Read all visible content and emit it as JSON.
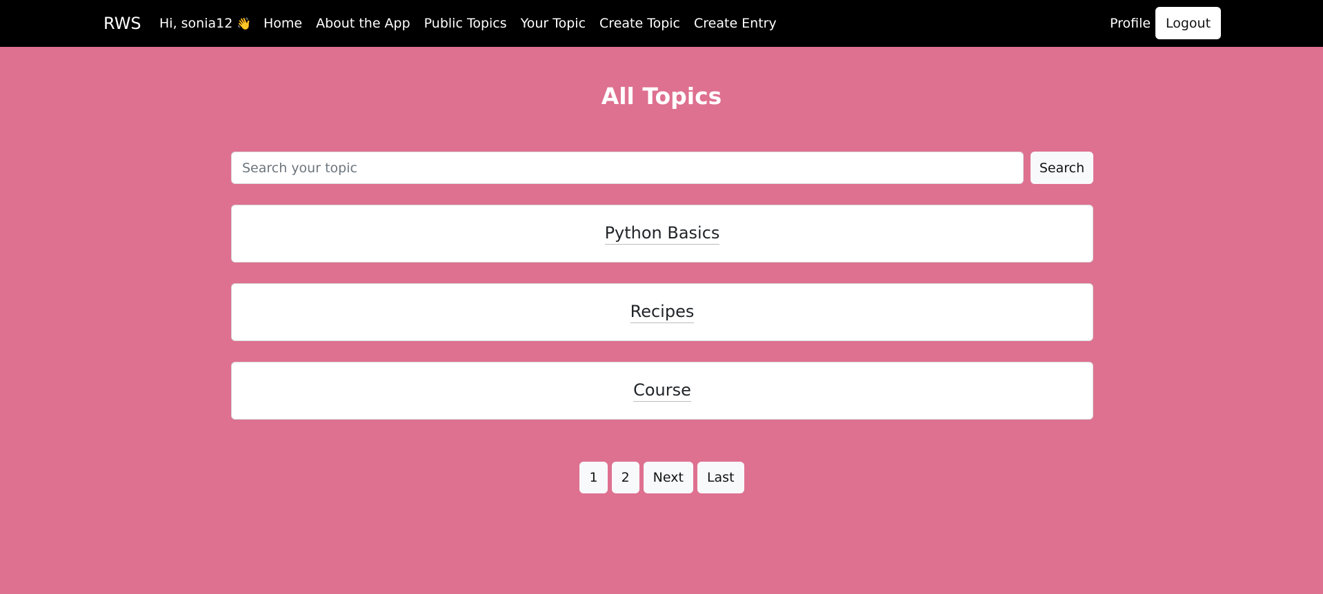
{
  "navbar": {
    "brand": "RWS",
    "greeting": "Hi, sonia12",
    "greeting_emoji": "👋",
    "links": [
      "Home",
      "About the App",
      "Public Topics",
      "Your Topic",
      "Create Topic",
      "Create Entry"
    ],
    "profile": "Profile",
    "logout": "Logout"
  },
  "main": {
    "title": "All Topics",
    "search": {
      "placeholder": "Search your topic",
      "value": "",
      "button": "Search"
    },
    "topics": [
      "Python Basics",
      "Recipes",
      "Course"
    ]
  },
  "pagination": {
    "pages": [
      "1",
      "2"
    ],
    "next": "Next",
    "last": "Last"
  },
  "colors": {
    "background": "#de7090",
    "navbar": "#000000",
    "card": "#ffffff"
  }
}
